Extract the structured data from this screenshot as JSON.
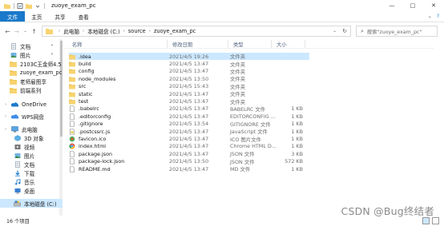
{
  "window": {
    "title": "zuoye_exam_pc",
    "controls": [
      "—",
      "□",
      "✕"
    ]
  },
  "ribbon": {
    "tabs": [
      "文件",
      "主页",
      "共享",
      "查看"
    ],
    "right_icons": [
      "chevron-down-icon",
      "help-icon"
    ]
  },
  "address": {
    "crumbs": [
      "此电脑",
      "本地磁盘 (C:)",
      "source",
      "zuoye_exam_pc"
    ],
    "search_placeholder": "搜索\"zuoye_exam_pc\""
  },
  "nav": {
    "items": [
      {
        "label": "文档",
        "icon": "documents-icon",
        "pinned": true
      },
      {
        "label": "图片",
        "icon": "pictures-icon",
        "pinned": true
      },
      {
        "label": "2103C王金师4.5",
        "icon": "folder-icon",
        "pinned": false
      },
      {
        "label": "zuoye_exam_pc",
        "icon": "folder-icon",
        "pinned": false
      },
      {
        "label": "老师雇图享",
        "icon": "folder-icon",
        "pinned": false
      },
      {
        "label": "前端系列",
        "icon": "folder-icon",
        "pinned": false
      },
      {
        "label": "OneDrive",
        "icon": "onedrive-icon",
        "pinned": false
      },
      {
        "label": "WPS网盘",
        "icon": "wps-cloud-icon",
        "pinned": false
      },
      {
        "label": "此电脑",
        "icon": "this-pc-icon",
        "pinned": false
      },
      {
        "label": "3D 对象",
        "icon": "3d-objects-icon",
        "pinned": false
      },
      {
        "label": "视频",
        "icon": "videos-icon",
        "pinned": false
      },
      {
        "label": "图片",
        "icon": "pictures-icon",
        "pinned": false
      },
      {
        "label": "文档",
        "icon": "documents-icon",
        "pinned": false
      },
      {
        "label": "下载",
        "icon": "downloads-icon",
        "pinned": false
      },
      {
        "label": "音乐",
        "icon": "music-icon",
        "pinned": false
      },
      {
        "label": "桌面",
        "icon": "desktop-icon",
        "pinned": false
      },
      {
        "label": "本地磁盘 (C:)",
        "icon": "drive-icon",
        "pinned": false,
        "selected": true
      }
    ]
  },
  "columns": {
    "name": "名称",
    "date": "修改日期",
    "type": "类型",
    "size": "大小"
  },
  "files": [
    {
      "name": ".idea",
      "date": "2021/4/5 19:26",
      "type": "文件夹",
      "size": "",
      "icon": "folder-icon",
      "selected": true
    },
    {
      "name": "build",
      "date": "2021/4/5 13:47",
      "type": "文件夹",
      "size": "",
      "icon": "folder-icon"
    },
    {
      "name": "config",
      "date": "2021/4/5 13:47",
      "type": "文件夹",
      "size": "",
      "icon": "folder-icon"
    },
    {
      "name": "node_modules",
      "date": "2021/4/5 13:50",
      "type": "文件夹",
      "size": "",
      "icon": "folder-icon"
    },
    {
      "name": "src",
      "date": "2021/4/5 15:43",
      "type": "文件夹",
      "size": "",
      "icon": "folder-icon"
    },
    {
      "name": "static",
      "date": "2021/4/5 13:47",
      "type": "文件夹",
      "size": "",
      "icon": "folder-icon"
    },
    {
      "name": "test",
      "date": "2021/4/5 13:47",
      "type": "文件夹",
      "size": "",
      "icon": "folder-icon"
    },
    {
      "name": ".babelrc",
      "date": "2021/4/5 13:47",
      "type": "BABELRC 文件",
      "size": "1 KB",
      "icon": "file-icon"
    },
    {
      "name": ".editorconfig",
      "date": "2021/4/5 13:47",
      "type": "EDITORCONFIG ...",
      "size": "1 KB",
      "icon": "file-icon"
    },
    {
      "name": ".gitignore",
      "date": "2021/4/5 13:54",
      "type": "GITIGNORE 文件",
      "size": "1 KB",
      "icon": "file-icon"
    },
    {
      "name": ".postcssrc.js",
      "date": "2021/4/5 13:47",
      "type": "JavaScript 文件",
      "size": "1 KB",
      "icon": "js-file-icon"
    },
    {
      "name": "favicon.ico",
      "date": "2021/4/5 13:47",
      "type": "ICO 图片文件",
      "size": "1 KB",
      "icon": "ico-file-icon"
    },
    {
      "name": "index.html",
      "date": "2021/4/5 13:47",
      "type": "Chrome HTML D...",
      "size": "1 KB",
      "icon": "chrome-html-icon"
    },
    {
      "name": "package.json",
      "date": "2021/4/5 13:47",
      "type": "JSON 文件",
      "size": "3 KB",
      "icon": "file-icon"
    },
    {
      "name": "package-lock.json",
      "date": "2021/4/5 13:50",
      "type": "JSON 文件",
      "size": "572 KB",
      "icon": "file-icon"
    },
    {
      "name": "README.md",
      "date": "2021/4/5 13:47",
      "type": "MD 文件",
      "size": "1 KB",
      "icon": "file-icon"
    }
  ],
  "status": {
    "count": "16 个项目"
  },
  "watermark": "CSDN @Bug终结者",
  "colors": {
    "folder": "#f8d36f",
    "accent": "#1979ca",
    "selection": "#cce8ff"
  }
}
